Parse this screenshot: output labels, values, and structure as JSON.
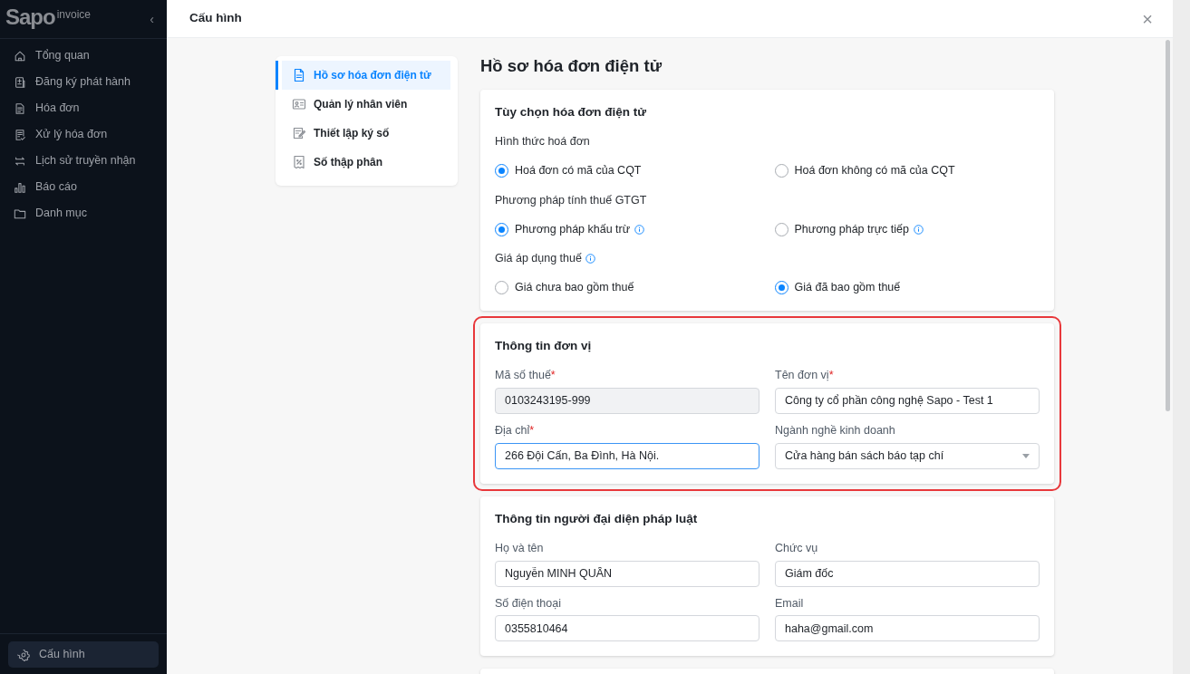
{
  "sidebar": {
    "logo": "Sapo",
    "logo_suffix": "invoice",
    "collapse": "‹",
    "items": [
      {
        "label": "Tổng quan",
        "selected": false
      },
      {
        "label": "Đăng ký phát hành",
        "selected": false
      },
      {
        "label": "Hóa đơn",
        "selected": false
      },
      {
        "label": "Xử lý hóa đơn",
        "selected": false
      },
      {
        "label": "Lịch sử truyền nhận",
        "selected": false
      },
      {
        "label": "Báo cáo",
        "selected": false
      },
      {
        "label": "Danh mục",
        "selected": false
      }
    ],
    "footer_item": {
      "label": "Cấu hình",
      "selected": true
    }
  },
  "dialog": {
    "title": "Cấu hình",
    "close": "×"
  },
  "settings_nav": [
    {
      "label": "Hồ sơ hóa đơn điện tử",
      "selected": true
    },
    {
      "label": "Quản lý nhân viên",
      "selected": false
    },
    {
      "label": "Thiết lập ký số",
      "selected": false
    },
    {
      "label": "Số thập phân",
      "selected": false
    }
  ],
  "page_title": "Hồ sơ hóa đơn điện tử",
  "options_section": {
    "title": "Tùy chọn hóa đơn điện tử",
    "groups": [
      {
        "label": "Hình thức hoá đơn",
        "info": false,
        "options": [
          {
            "label": "Hoá đơn có mã của CQT",
            "selected": true,
            "info": false
          },
          {
            "label": "Hoá đơn không có mã của CQT",
            "selected": false,
            "info": false
          }
        ]
      },
      {
        "label": "Phương pháp tính thuế GTGT",
        "info": false,
        "options": [
          {
            "label": "Phương pháp khấu trừ",
            "selected": true,
            "info": true
          },
          {
            "label": "Phương pháp trực tiếp",
            "selected": false,
            "info": true
          }
        ]
      },
      {
        "label": "Giá áp dụng thuế",
        "info": true,
        "options": [
          {
            "label": "Giá chưa bao gồm thuế",
            "selected": false,
            "info": false
          },
          {
            "label": "Giá đã bao gồm thuế",
            "selected": true,
            "info": false
          }
        ]
      }
    ]
  },
  "field_sections": [
    {
      "title": "Thông tin đơn vị",
      "highlighted": true,
      "fields": [
        {
          "label": "Mã số thuế",
          "required_mark": "*",
          "kind": "text",
          "value": "0103243195-999",
          "disabled": true,
          "focused": false
        },
        {
          "label": "Tên đơn vị",
          "required_mark": "*",
          "kind": "text",
          "value": "Công ty cổ phần công nghệ Sapo - Test 1",
          "disabled": false,
          "focused": false
        },
        {
          "label": "Địa chỉ",
          "required_mark": "*",
          "kind": "text",
          "value": "266 Đội Cấn, Ba Đình, Hà Nội.",
          "disabled": false,
          "focused": true
        },
        {
          "label": "Ngành nghề kinh doanh",
          "kind": "select",
          "value": "Cửa hàng bán sách báo tạp chí",
          "disabled": false,
          "focused": false
        }
      ]
    },
    {
      "title": "Thông tin người đại diện pháp luật",
      "highlighted": false,
      "fields": [
        {
          "label": "Họ và tên",
          "kind": "text",
          "value": "Nguyễn MINH QUÂN",
          "disabled": false,
          "focused": false
        },
        {
          "label": "Chức vụ",
          "kind": "text",
          "value": "Giám đốc",
          "disabled": false,
          "focused": false
        },
        {
          "label": "Số điện thoại",
          "kind": "text",
          "value": "0355810464",
          "disabled": false,
          "focused": false
        },
        {
          "label": "Email",
          "kind": "text",
          "value": "haha@gmail.com",
          "disabled": false,
          "focused": false
        }
      ]
    }
  ]
}
